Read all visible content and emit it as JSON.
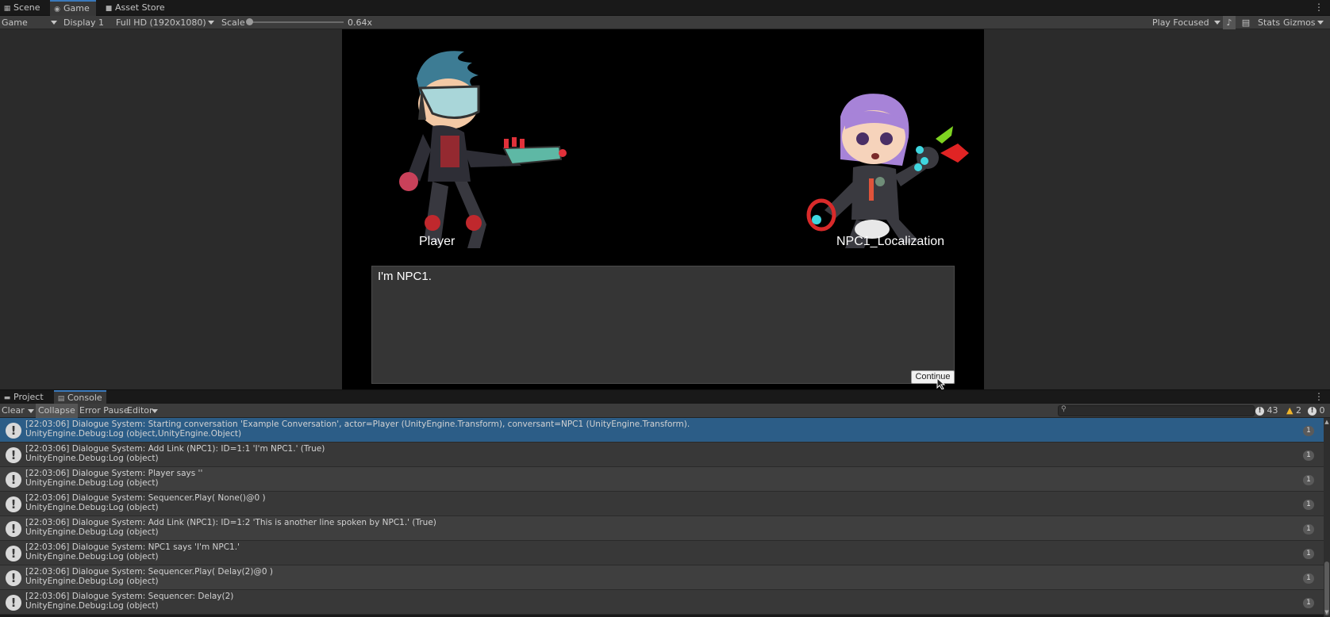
{
  "top_tabs": [
    {
      "label": "Scene",
      "icon": "scene-icon"
    },
    {
      "label": "Game",
      "icon": "game-controller-icon",
      "active": true
    },
    {
      "label": "Asset Store",
      "icon": "store-icon"
    }
  ],
  "game_toolbar": {
    "mode": "Game",
    "display": "Display 1",
    "resolution": "Full HD (1920x1080)",
    "scale_label": "Scale",
    "scale_value": "0.64x",
    "play_mode": "Play Focused",
    "stats_label": "Stats",
    "gizmos_label": "Gizmos"
  },
  "game": {
    "player_name": "Player",
    "npc_name": "NPC1_Localization",
    "dialogue_text": "I'm NPC1.",
    "continue_label": "Continue"
  },
  "console_tabs": [
    {
      "label": "Project",
      "icon": "folder-icon"
    },
    {
      "label": "Console",
      "icon": "console-icon",
      "active": true
    }
  ],
  "console_toolbar": {
    "clear_label": "Clear",
    "collapse_label": "Collapse",
    "error_pause_label": "Error Pause",
    "editor_label": "Editor",
    "info_count": "43",
    "warning_count": "2",
    "error_count": "0"
  },
  "logs": [
    {
      "line1": "[22:03:06] Dialogue System: Starting conversation 'Example Conversation', actor=Player (UnityEngine.Transform), conversant=NPC1 (UnityEngine.Transform).",
      "line2": "UnityEngine.Debug:Log (object,UnityEngine.Object)",
      "count": "1"
    },
    {
      "line1": "[22:03:06] Dialogue System: Add Link (NPC1): ID=1:1 'I'm NPC1.' (True)",
      "line2": "UnityEngine.Debug:Log (object)",
      "count": "1"
    },
    {
      "line1": "[22:03:06] Dialogue System: Player says ''",
      "line2": "UnityEngine.Debug:Log (object)",
      "count": "1"
    },
    {
      "line1": "[22:03:06] Dialogue System: Sequencer.Play( None()@0 )",
      "line2": "UnityEngine.Debug:Log (object)",
      "count": "1"
    },
    {
      "line1": "[22:03:06] Dialogue System: Add Link (NPC1): ID=1:2 'This is another line spoken by NPC1.' (True)",
      "line2": "UnityEngine.Debug:Log (object)",
      "count": "1"
    },
    {
      "line1": "[22:03:06] Dialogue System: NPC1 says 'I'm NPC1.'",
      "line2": "UnityEngine.Debug:Log (object)",
      "count": "1"
    },
    {
      "line1": "[22:03:06] Dialogue System: Sequencer.Play( Delay(2)@0 )",
      "line2": "UnityEngine.Debug:Log (object)",
      "count": "1"
    },
    {
      "line1": "[22:03:06] Dialogue System: Sequencer: Delay(2)",
      "line2": "UnityEngine.Debug:Log (object)",
      "count": "1"
    }
  ]
}
